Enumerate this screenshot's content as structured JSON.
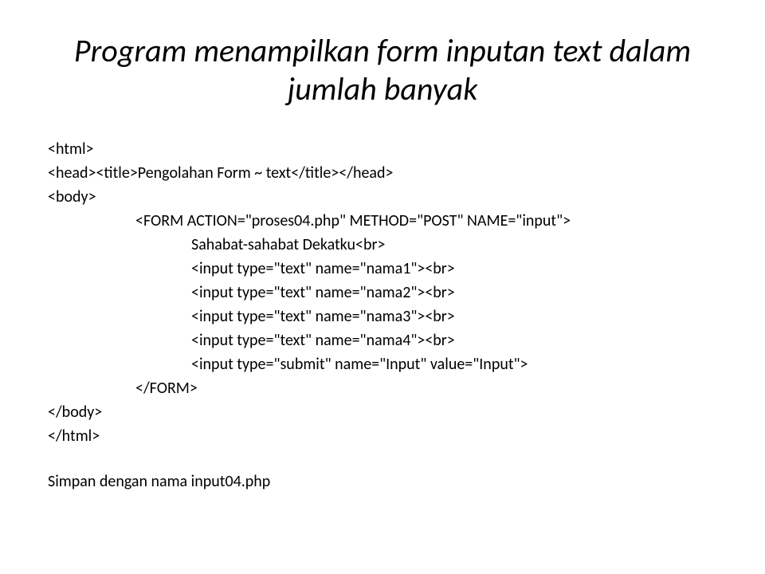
{
  "title": "Program menampilkan form inputan text dalam jumlah banyak",
  "code": {
    "l1": "<html>",
    "l2": "<head><title>Pengolahan Form ~ text</title></head>",
    "l3": "<body>",
    "l4": "<FORM ACTION=\"proses04.php\" METHOD=\"POST\" NAME=\"input\">",
    "l5": "Sahabat-sahabat Dekatku<br>",
    "l6": "<input type=\"text\" name=\"nama1\"><br>",
    "l7": "<input type=\"text\" name=\"nama2\"><br>",
    "l8": "<input type=\"text\" name=\"nama3\"><br>",
    "l9": "<input type=\"text\" name=\"nama4\"><br>",
    "l10": "<input type=\"submit\" name=\"Input\" value=\"Input\">",
    "l11": "</FORM>",
    "l12": "</body>",
    "l13": "</html>"
  },
  "footer": "Simpan dengan nama input04.php"
}
